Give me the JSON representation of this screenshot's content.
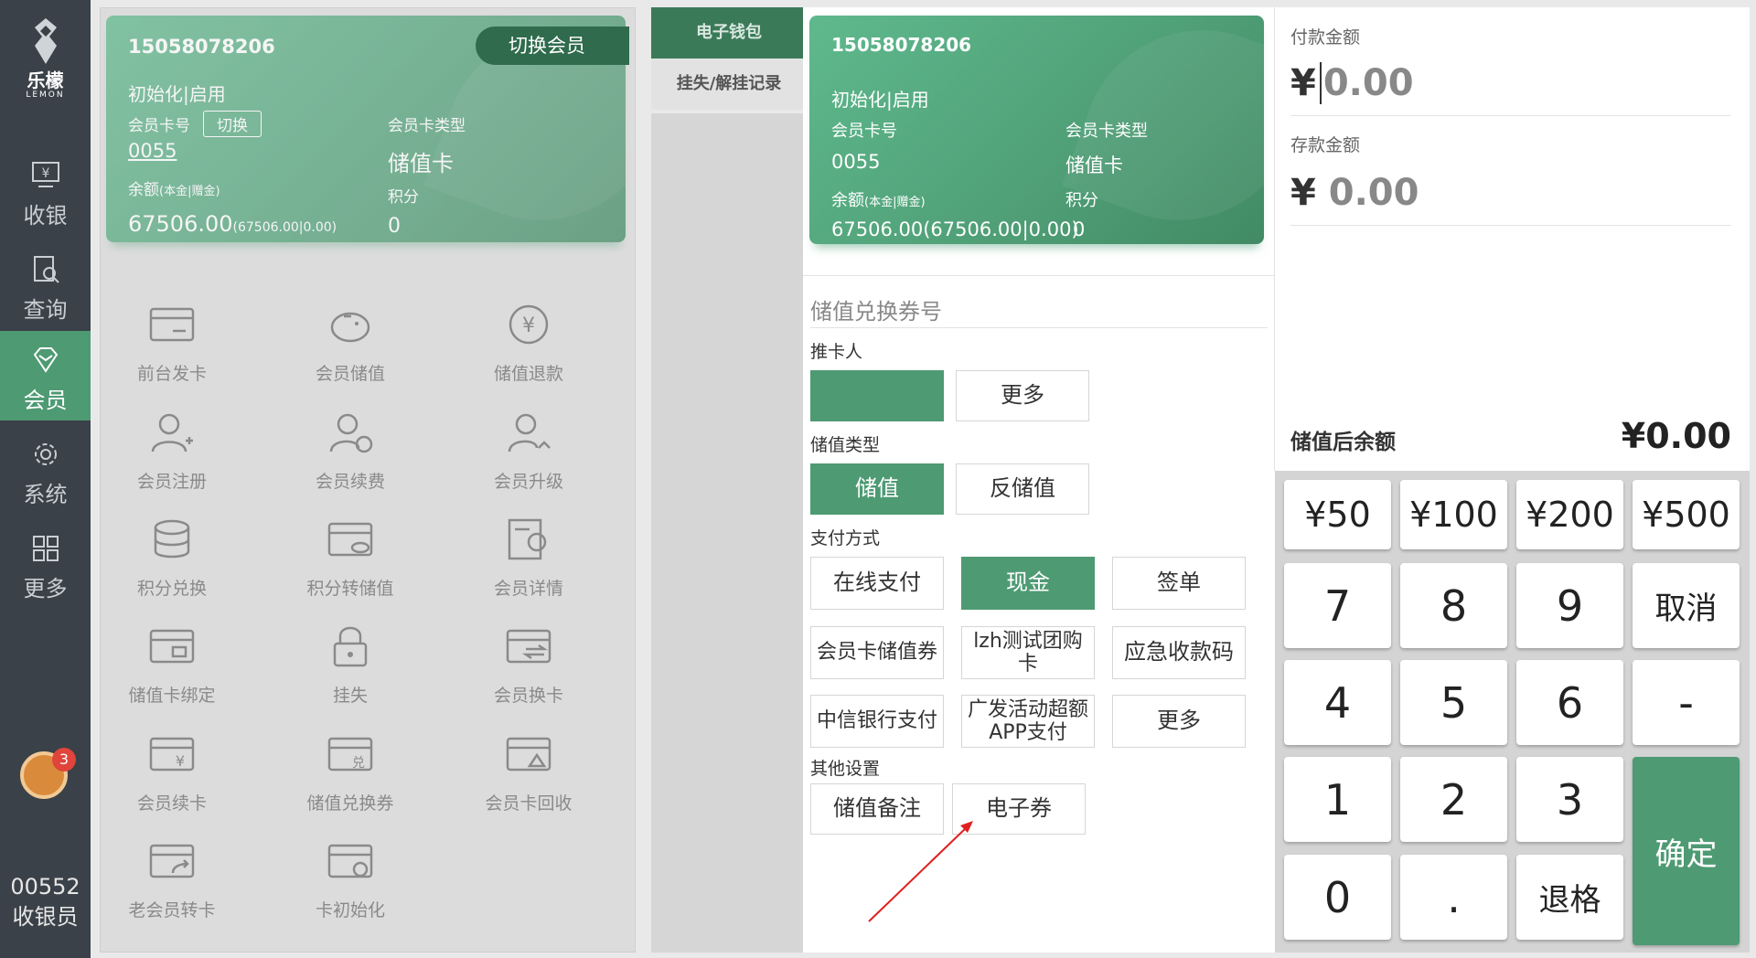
{
  "sidebar": {
    "brand_cn": "乐檬",
    "brand_en": "LEMON",
    "items": [
      {
        "label": "收银",
        "icon": "cashier-icon"
      },
      {
        "label": "查询",
        "icon": "query-icon"
      },
      {
        "label": "会员",
        "icon": "member-diamond-icon"
      },
      {
        "label": "系统",
        "icon": "gear-icon"
      },
      {
        "label": "更多",
        "icon": "grid-icon"
      }
    ],
    "notification_count": "3",
    "user_id": "00552",
    "user_role": "收银员"
  },
  "left_card": {
    "phone": "15058078206",
    "switch_member": "切换会员",
    "status": "初始化|启用",
    "card_no_label": "会员卡号",
    "switch_label": "切换",
    "card_no": "0055",
    "card_type_label": "会员卡类型",
    "card_type": "储值卡",
    "balance_label": "余额",
    "balance_sub": "(本金|赠金)",
    "points_label": "积分",
    "balance": "67506.00",
    "balance_detail": "(67506.00|0.00)",
    "points": "0"
  },
  "functions": [
    {
      "label": "前台发卡",
      "icon": "card-issue-icon"
    },
    {
      "label": "会员储值",
      "icon": "piggy-bank-icon"
    },
    {
      "label": "储值退款",
      "icon": "refund-icon"
    },
    {
      "label": "会员注册",
      "icon": "user-add-icon"
    },
    {
      "label": "会员续费",
      "icon": "user-renew-icon"
    },
    {
      "label": "会员升级",
      "icon": "user-upgrade-icon"
    },
    {
      "label": "积分兑换",
      "icon": "coins-icon"
    },
    {
      "label": "积分转储值",
      "icon": "points-transfer-icon"
    },
    {
      "label": "会员详情",
      "icon": "member-detail-icon"
    },
    {
      "label": "储值卡绑定",
      "icon": "card-bind-icon"
    },
    {
      "label": "挂失",
      "icon": "lock-icon"
    },
    {
      "label": "会员换卡",
      "icon": "card-swap-icon"
    },
    {
      "label": "会员续卡",
      "icon": "card-renew-icon"
    },
    {
      "label": "储值兑换券",
      "icon": "voucher-icon"
    },
    {
      "label": "会员卡回收",
      "icon": "card-recycle-icon"
    },
    {
      "label": "老会员转卡",
      "icon": "card-transfer-icon"
    },
    {
      "label": "卡初始化",
      "icon": "card-init-icon"
    }
  ],
  "mid_tabs": {
    "tab1": "电子钱包",
    "tab2": "挂失/解挂记录"
  },
  "modal_card": {
    "phone": "15058078206",
    "status": "初始化|启用",
    "card_no_label": "会员卡号",
    "card_type_label": "会员卡类型",
    "card_no": "0055",
    "card_type": "储值卡",
    "balance_label": "余额",
    "balance_sub": "(本金|赠金)",
    "points_label": "积分",
    "balance": "67506.00(67506.00|0.00)",
    "points": "0"
  },
  "form": {
    "voucher_placeholder": "储值兑换券号",
    "referrer_label": "推卡人",
    "referrer_more": "更多",
    "type_label": "储值类型",
    "type_options": [
      "储值",
      "反储值"
    ],
    "pay_label": "支付方式",
    "pay_methods": [
      "在线支付",
      "现金",
      "签单",
      "会员卡储值券",
      "lzh测试团购卡",
      "应急收款码",
      "中信银行支付",
      "广发活动超额APP支付",
      "更多"
    ],
    "other_label": "其他设置",
    "other_options": [
      "储值备注",
      "电子券"
    ]
  },
  "payment": {
    "pay_amount_label": "付款金额",
    "pay_amount": "0.00",
    "deposit_label": "存款金额",
    "deposit_amount": "0.00",
    "yen": "¥",
    "after_label": "储值后余额",
    "after_amount": "¥0.00"
  },
  "keypad": {
    "quick": [
      "¥50",
      "¥100",
      "¥200",
      "¥500"
    ],
    "digits": [
      "7",
      "8",
      "9",
      "4",
      "5",
      "6",
      "1",
      "2",
      "3",
      "0",
      "."
    ],
    "cancel": "取消",
    "minus": "-",
    "confirm": "确定",
    "backspace": "退格"
  },
  "colors": {
    "accent_green": "#4e9a73",
    "sidebar_bg": "#3a4148",
    "arrow_red": "#e02020"
  }
}
